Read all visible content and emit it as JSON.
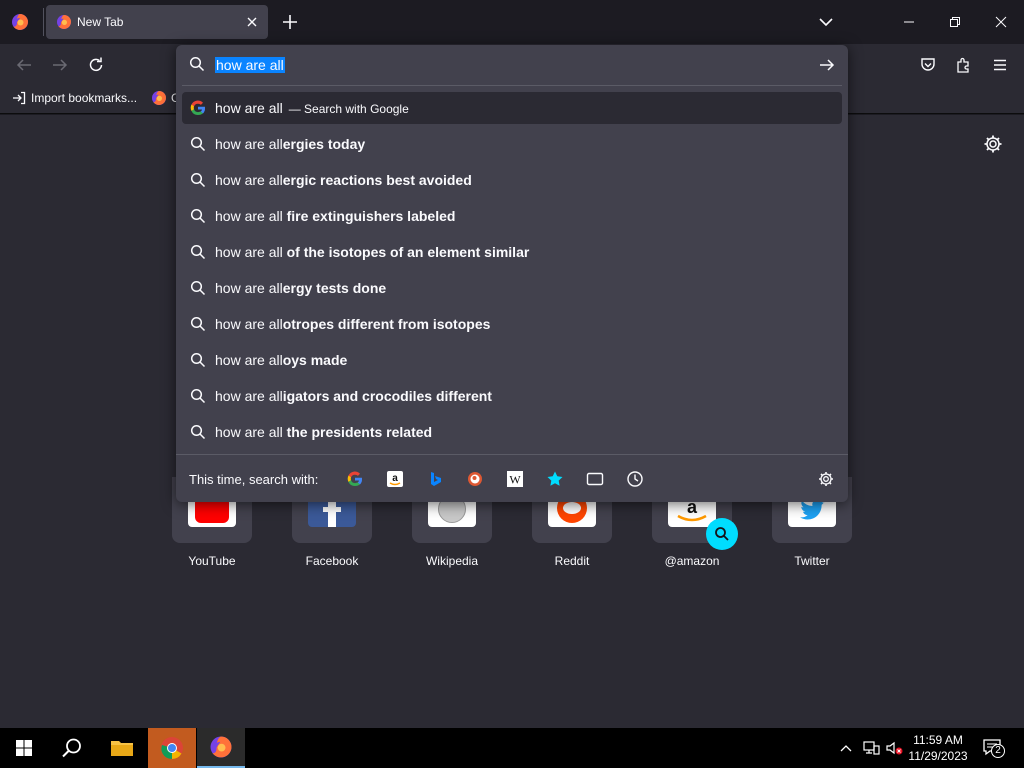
{
  "tab": {
    "title": "New Tab"
  },
  "bookmarks": {
    "import_label": "Import bookmarks...",
    "firefox_label": "G"
  },
  "urlbar": {
    "value": "how are all",
    "results": [
      {
        "prefix": "how are all",
        "bold": "",
        "action": "— Search with Google",
        "icon": "google-icon",
        "active": true
      },
      {
        "prefix": "how are all",
        "bold": "ergies today",
        "action": "",
        "icon": "search-icon"
      },
      {
        "prefix": "how are all",
        "bold": "ergic reactions best avoided",
        "action": "",
        "icon": "search-icon"
      },
      {
        "prefix": "how are all ",
        "bold": "fire extinguishers labeled",
        "action": "",
        "icon": "search-icon"
      },
      {
        "prefix": "how are all ",
        "bold": "of the isotopes of an element similar",
        "action": "",
        "icon": "search-icon"
      },
      {
        "prefix": "how are all",
        "bold": "ergy tests done",
        "action": "",
        "icon": "search-icon"
      },
      {
        "prefix": "how are all",
        "bold": "otropes different from isotopes",
        "action": "",
        "icon": "search-icon"
      },
      {
        "prefix": "how are all",
        "bold": "oys made",
        "action": "",
        "icon": "search-icon"
      },
      {
        "prefix": "how are all",
        "bold": "igators and crocodiles different",
        "action": "",
        "icon": "search-icon"
      },
      {
        "prefix": "how are all ",
        "bold": "the presidents related",
        "action": "",
        "icon": "search-icon"
      }
    ],
    "oneoff_label": "This time, search with:",
    "engines": [
      "google-icon",
      "amazon-icon",
      "bing-icon",
      "duckduckgo-icon",
      "wikipedia-icon",
      "bookmarks-star-icon",
      "tabs-icon",
      "history-icon"
    ]
  },
  "top_sites": [
    {
      "label": "YouTube",
      "icon": "youtube-icon"
    },
    {
      "label": "Facebook",
      "icon": "facebook-icon"
    },
    {
      "label": "Wikipedia",
      "icon": "wikipedia-icon"
    },
    {
      "label": "Reddit",
      "icon": "reddit-icon"
    },
    {
      "label": "@amazon",
      "icon": "amazon-icon"
    },
    {
      "label": "Twitter",
      "icon": "twitter-icon"
    }
  ],
  "clock": {
    "time": "11:59 AM",
    "date": "11/29/2023"
  },
  "notifications": {
    "count": "2"
  },
  "colors": {
    "accent": "#0a84ff",
    "background": "#2b2a33",
    "panel": "#42414d"
  }
}
